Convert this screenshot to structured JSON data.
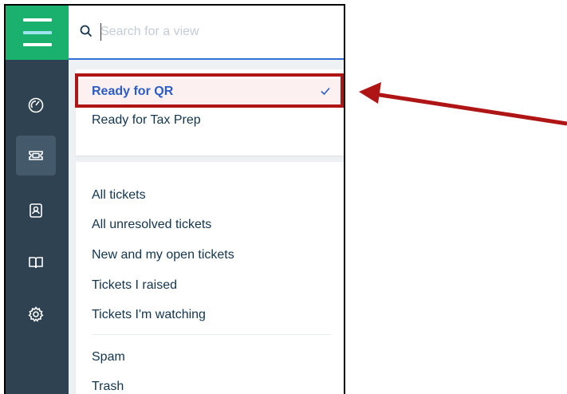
{
  "search": {
    "placeholder": "Search for a view",
    "value": ""
  },
  "rail": {
    "items": [
      {
        "icon": "dashboard-icon"
      },
      {
        "icon": "ticket-icon",
        "active": true
      },
      {
        "icon": "contact-icon"
      },
      {
        "icon": "book-icon"
      },
      {
        "icon": "gear-icon"
      }
    ]
  },
  "views": {
    "pinned": [
      {
        "label": "Ready for QR",
        "selected": true
      },
      {
        "label": "Ready for Tax Prep"
      }
    ],
    "standard": [
      {
        "label": "All tickets"
      },
      {
        "label": "All unresolved tickets"
      },
      {
        "label": "New and my open tickets"
      },
      {
        "label": "Tickets I raised"
      },
      {
        "label": "Tickets I'm watching"
      }
    ],
    "other": [
      {
        "label": "Spam"
      },
      {
        "label": "Trash"
      }
    ]
  },
  "colors": {
    "rail": "#2e4252",
    "logo": "#1ab16f",
    "selected_text": "#2c5cc5",
    "highlight": "#b01515"
  }
}
